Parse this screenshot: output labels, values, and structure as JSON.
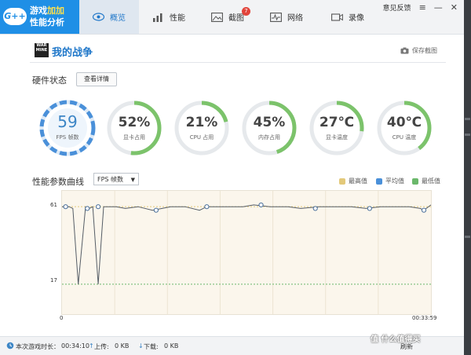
{
  "app": {
    "logo_badge": "G++",
    "logo_line1_a": "游戏",
    "logo_line1_b": "加加",
    "logo_line2": "性能分析"
  },
  "tabs": [
    {
      "label": "概览",
      "active": true
    },
    {
      "label": "性能"
    },
    {
      "label": "截图",
      "badge": "7"
    },
    {
      "label": "网络"
    },
    {
      "label": "录像"
    }
  ],
  "titlebar": {
    "feedback": "意见反馈"
  },
  "game": {
    "icon_text": "WAR MINE",
    "title": "我的战争",
    "screenshot_label": "保存截图"
  },
  "hardware": {
    "title": "硬件状态",
    "details_button": "查看详情",
    "gauges": [
      {
        "value": "59",
        "label": "FPS 帧数",
        "fraction": 0.8,
        "color": "#4a90d9"
      },
      {
        "value": "52%",
        "label": "显卡占用",
        "fraction": 0.52,
        "color": "#7cc36b"
      },
      {
        "value": "21%",
        "label": "CPU 占用",
        "fraction": 0.21,
        "color": "#7cc36b"
      },
      {
        "value": "45%",
        "label": "内存占用",
        "fraction": 0.45,
        "color": "#7cc36b"
      },
      {
        "value": "27℃",
        "label": "显卡温度",
        "fraction": 0.27,
        "color": "#7cc36b"
      },
      {
        "value": "40℃",
        "label": "CPU 温度",
        "fraction": 0.4,
        "color": "#7cc36b"
      }
    ]
  },
  "chart_section": {
    "title": "性能参数曲线",
    "metric_selected": "FPS 帧数"
  },
  "chart_data": {
    "type": "line",
    "legend": [
      {
        "name": "最高值",
        "color": "#e3c97a"
      },
      {
        "name": "平均值",
        "color": "#4a90d9"
      },
      {
        "name": "最低值",
        "color": "#6bb86b"
      }
    ],
    "x_start_label": "0",
    "x_end_label": "00:33:59",
    "x_range_seconds": [
      0,
      2039
    ],
    "ylim": [
      0,
      70
    ],
    "max_line": 61,
    "min_line": 17,
    "y_labels": [
      "61",
      "17"
    ],
    "series": [
      {
        "values": [
          [
            0,
            61
          ],
          [
            40,
            61
          ],
          [
            60,
            60
          ],
          [
            90,
            17
          ],
          [
            130,
            61
          ],
          [
            150,
            60
          ],
          [
            170,
            61
          ],
          [
            200,
            17
          ],
          [
            230,
            61
          ],
          [
            260,
            61
          ],
          [
            300,
            61
          ],
          [
            350,
            60
          ],
          [
            420,
            61
          ],
          [
            500,
            59
          ],
          [
            600,
            61
          ],
          [
            680,
            61
          ],
          [
            760,
            59
          ],
          [
            800,
            61
          ],
          [
            900,
            61
          ],
          [
            1000,
            61
          ],
          [
            1060,
            62
          ],
          [
            1150,
            61
          ],
          [
            1250,
            61
          ],
          [
            1320,
            60
          ],
          [
            1420,
            61
          ],
          [
            1520,
            61
          ],
          [
            1600,
            61
          ],
          [
            1680,
            60
          ],
          [
            1760,
            61
          ],
          [
            1850,
            61
          ],
          [
            1920,
            61
          ],
          [
            1980,
            60
          ],
          [
            2000,
            59
          ],
          [
            2039,
            62
          ]
        ]
      }
    ],
    "markers": [
      [
        20,
        61
      ],
      [
        140,
        60
      ],
      [
        200,
        61
      ],
      [
        520,
        59
      ],
      [
        800,
        61
      ],
      [
        1100,
        62
      ],
      [
        1400,
        60
      ],
      [
        1700,
        60
      ],
      [
        2000,
        59
      ]
    ]
  },
  "status": {
    "duration_label": "本次游戏时长：",
    "duration_value": "00:34:10",
    "upload_label": "上传:",
    "upload_value": "0 KB",
    "download_label": "下载:",
    "download_value": "0 KB",
    "trailing": "刷新"
  },
  "watermark": "值 什么值得买"
}
